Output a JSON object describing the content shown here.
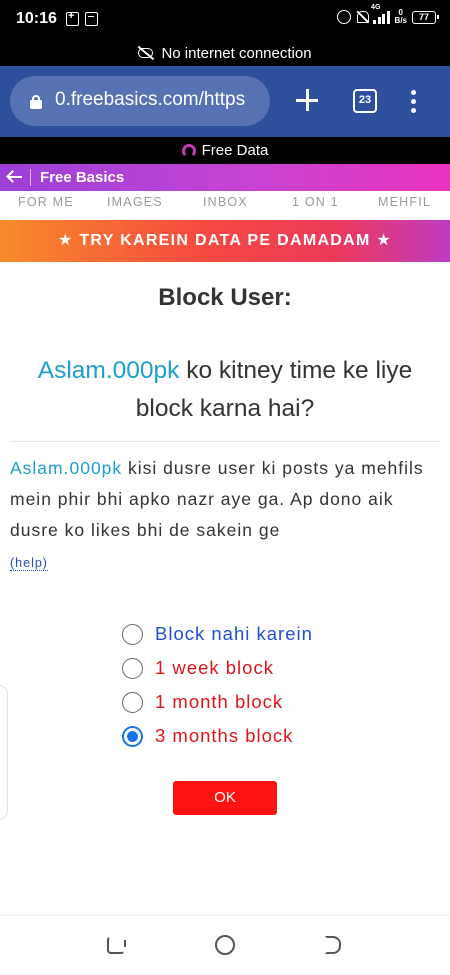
{
  "status_bar": {
    "time": "10:16",
    "network_tag": "4G",
    "net_speed_value": "0",
    "net_speed_unit": "B/s",
    "battery": "77"
  },
  "connection_banner": {
    "text": "No internet connection"
  },
  "browser": {
    "url": "0.freebasics.com/https",
    "tab_count": "23"
  },
  "free_data": {
    "text": "Free Data"
  },
  "header": {
    "title": "Free Basics"
  },
  "nav": {
    "items": [
      "FOR ME",
      "IMAGES",
      "INBOX",
      "1 ON 1",
      "MEHFIL"
    ]
  },
  "promo": {
    "text": "★ TRY KAREIN DATA PE DAMADAM ★"
  },
  "page": {
    "title": "Block User:",
    "username": "Aslam.000pk",
    "question_rest": " ko kitney time ke liye block karna hai?",
    "description_rest": " kisi dusre user ki posts ya mehfils mein phir bhi apko nazr aye ga. Ap dono aik dusre ko likes bhi de sakein ge",
    "help_label": "(help)"
  },
  "options": [
    {
      "label": "Block nahi karein",
      "color": "#1f4fd1",
      "selected": false
    },
    {
      "label": "1 week block",
      "color": "#e0151b",
      "selected": false
    },
    {
      "label": "1 month block",
      "color": "#e0151b",
      "selected": false
    },
    {
      "label": "3 months block",
      "color": "#e0151b",
      "selected": true
    }
  ],
  "ok_button": {
    "label": "OK",
    "color": "#ff1212"
  },
  "colors": {
    "accent_link": "#1ba0d1",
    "toolbar": "#2e4f9c",
    "radio_selected": "#1a73e8"
  }
}
